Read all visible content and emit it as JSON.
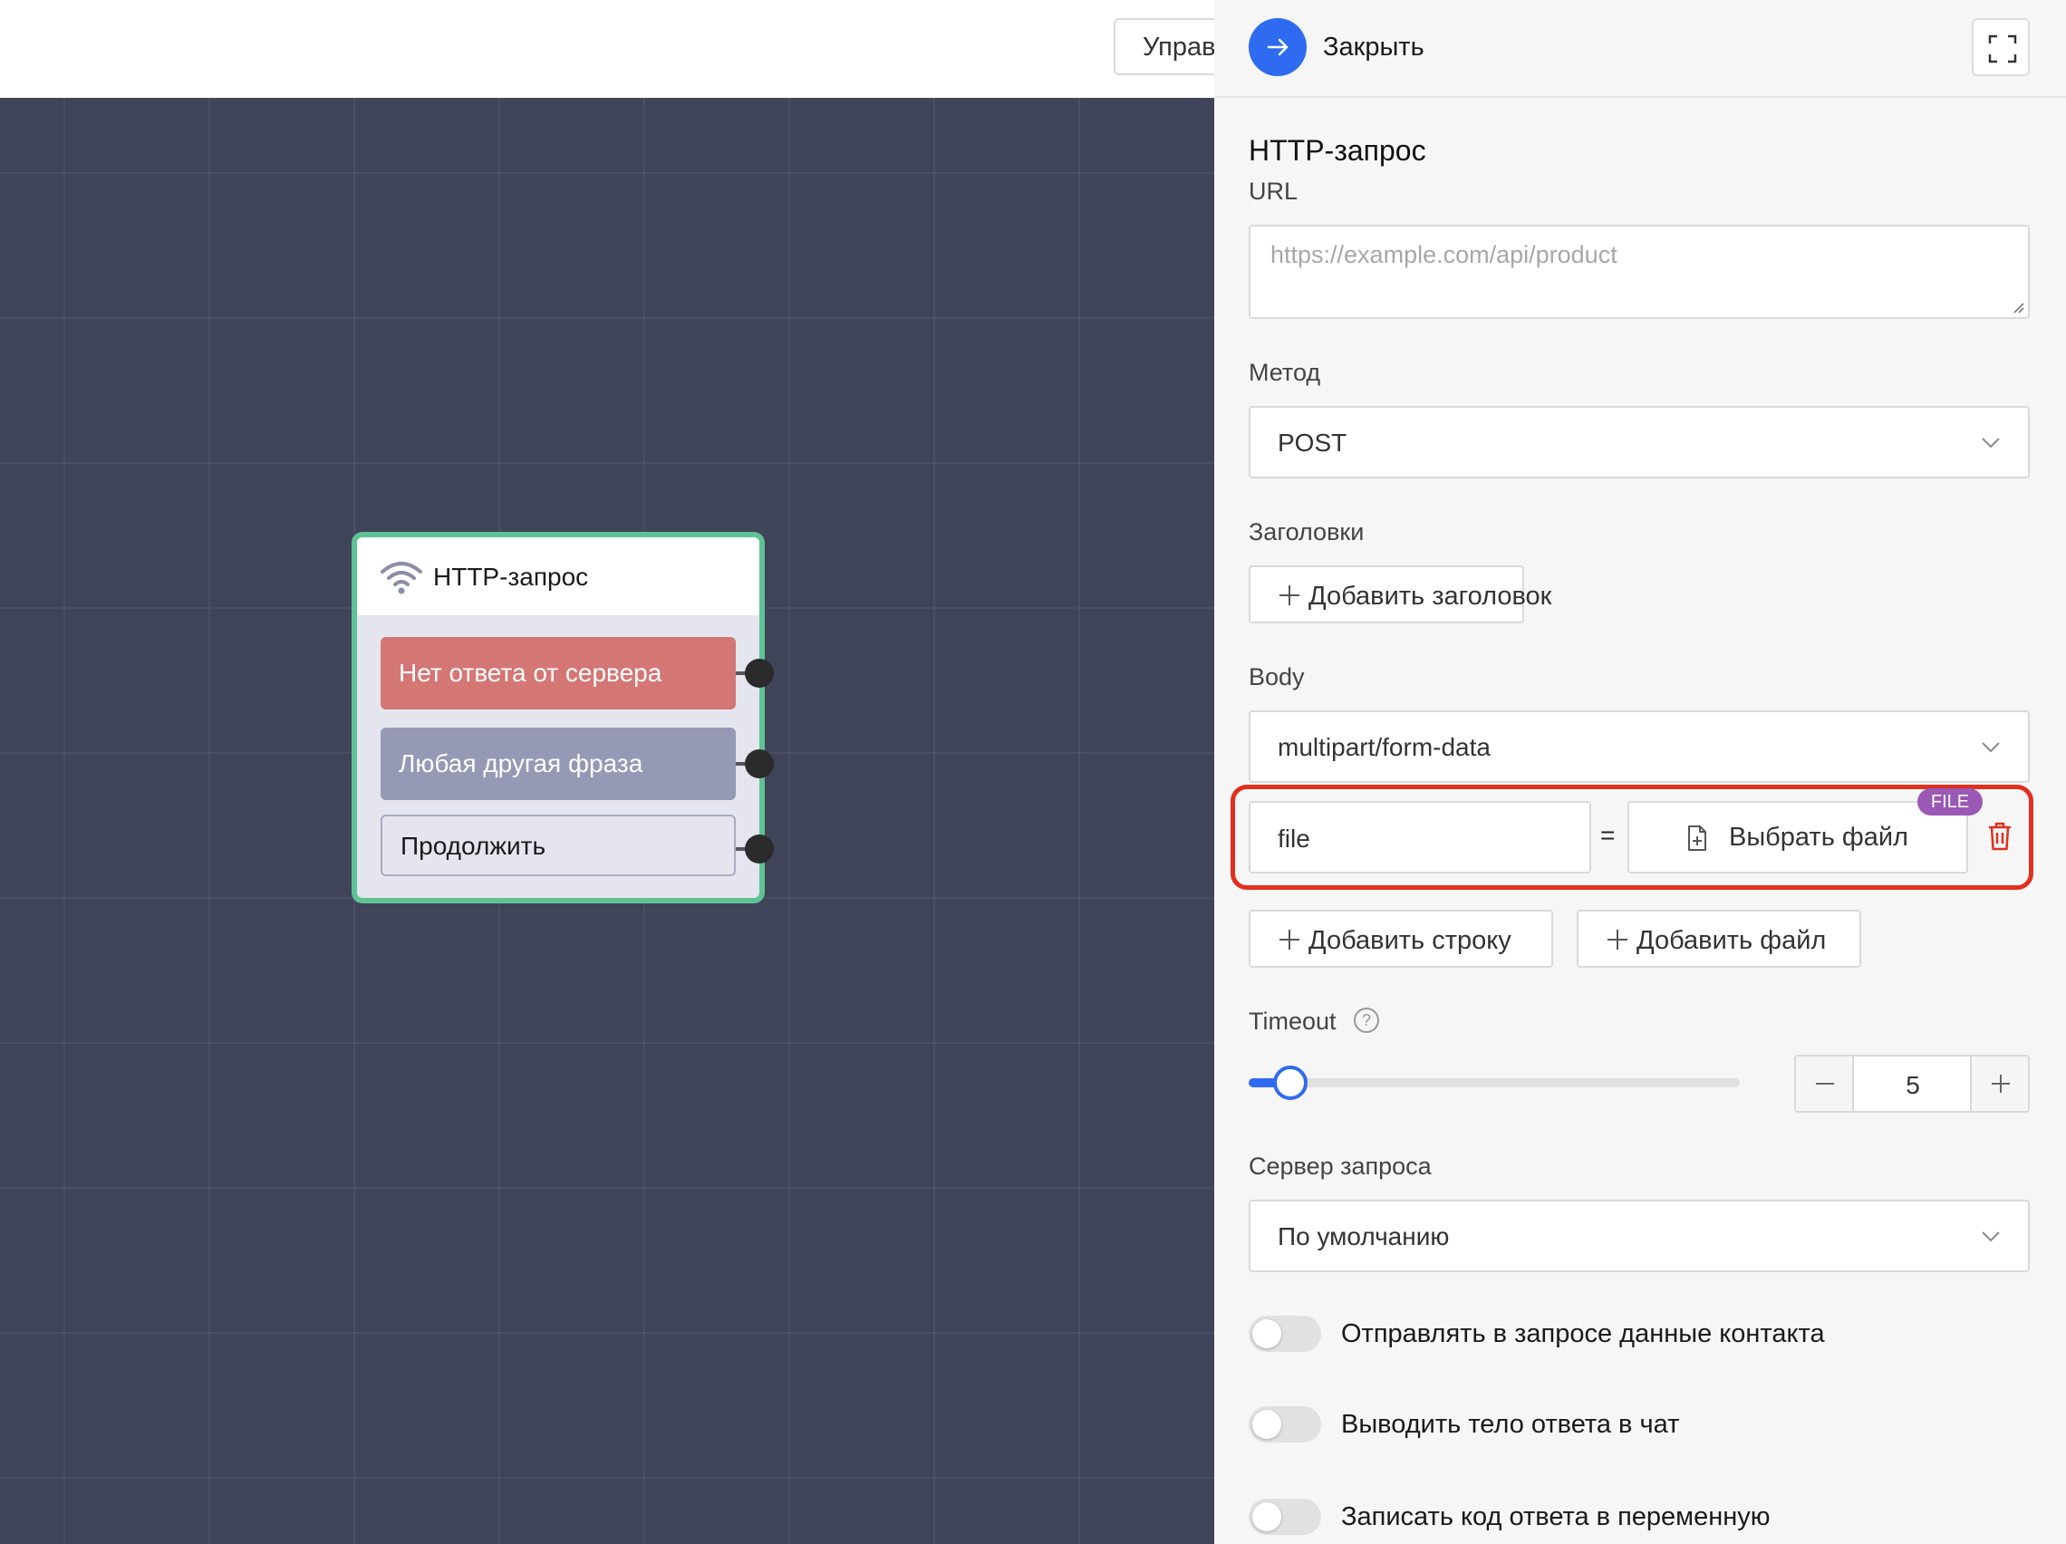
{
  "topbar": {
    "manage_label": "Управ"
  },
  "node": {
    "title": "HTTP-запрос",
    "buttons": [
      {
        "label": "Нет ответа от сервера",
        "color": "#d47774"
      },
      {
        "label": "Любая другая фраза",
        "color": "#9599b5"
      },
      {
        "label": "Продолжить",
        "color": "#e4e5ef"
      }
    ],
    "border_color": "#5fc295"
  },
  "panel": {
    "close_label": "Закрыть",
    "title": "HTTP-запрос",
    "url": {
      "label": "URL",
      "placeholder": "https://example.com/api/product",
      "value": ""
    },
    "method": {
      "label": "Метод",
      "value": "POST"
    },
    "headers": {
      "label": "Заголовки",
      "add_label": "Добавить заголовок"
    },
    "body": {
      "label": "Body",
      "type": "multipart/form-data",
      "row": {
        "key": "file",
        "separator": "=",
        "file_button": "Выбрать файл",
        "badge": "FILE"
      },
      "add_row_label": "Добавить строку",
      "add_file_label": "Добавить файл"
    },
    "timeout": {
      "label": "Timeout",
      "help": "?",
      "value": "5",
      "slider_fraction": 0.05
    },
    "server": {
      "label": "Сервер запроса",
      "value": "По умолчанию"
    },
    "toggles": [
      {
        "label": "Отправлять в запросе данные контакта",
        "on": false
      },
      {
        "label": "Выводить тело ответа в чат",
        "on": false
      },
      {
        "label": "Записать код ответа в переменную",
        "on": false
      }
    ]
  },
  "colors": {
    "accent": "#2f6bf0",
    "highlight": "#e0301e",
    "badge": "#9b59b6",
    "canvas": "#3f4459"
  }
}
